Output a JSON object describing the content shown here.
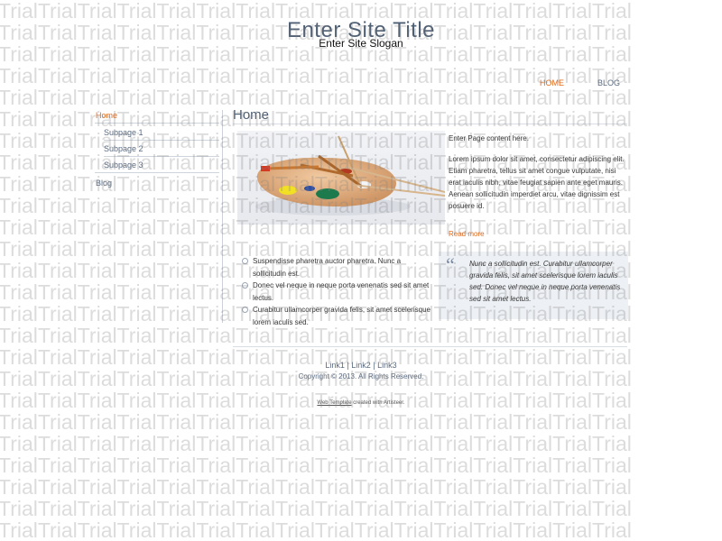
{
  "watermark": {
    "word": "Trial"
  },
  "header": {
    "title": "Enter Site Title",
    "slogan": "Enter Site Slogan"
  },
  "top_nav": [
    {
      "label": "HOME",
      "active": true
    },
    {
      "label": "BLOG",
      "active": false
    }
  ],
  "sidebar": {
    "items": [
      {
        "label": "Home"
      },
      {
        "label": "Subpage 1"
      },
      {
        "label": "Subpage 2"
      },
      {
        "label": "Subpage 3"
      },
      {
        "label": "Blog"
      }
    ]
  },
  "main": {
    "page_title": "Home",
    "intro": "Enter Page content here.",
    "body": "Lorem ipsum dolor sit amet, consectetur adipiscing elit. Etiam pharetra, tellus sit amet congue vulputate, nisi erat iaculis nibh, vitae feugiat sapien ante eget mauris. Aenean sollicitudin imperdiet arcu, vitae dignissim est posuere id.",
    "read_more": "Read more",
    "bullets": [
      "Suspendisse pharetra auctor pharetra. Nunc a sollicitudin est.",
      "Donec vel neque in neque porta venenatis sed sit amet lectus.",
      "Curabitur ullamcorper gravida felis, sit amet scelerisque lorem iaculis sed."
    ],
    "quote": "Nunc a sollicitudin est. Curabitur ullamcorper gravida felis, sit amet scelerisque lorem iaculis sed. Donec vel neque in neque porta venenatis sed sit amet lectus."
  },
  "footer": {
    "links": [
      "Link1",
      "Link2",
      "Link3"
    ],
    "separator": " | ",
    "copyright": "Copyright © 2013. All Rights Reserved.",
    "credit_link": "Web Template",
    "credit_rest": " created with Artisteer."
  },
  "colors": {
    "accent": "#e2691a",
    "nav_text": "#5b6b81",
    "title": "#4f5f74"
  }
}
